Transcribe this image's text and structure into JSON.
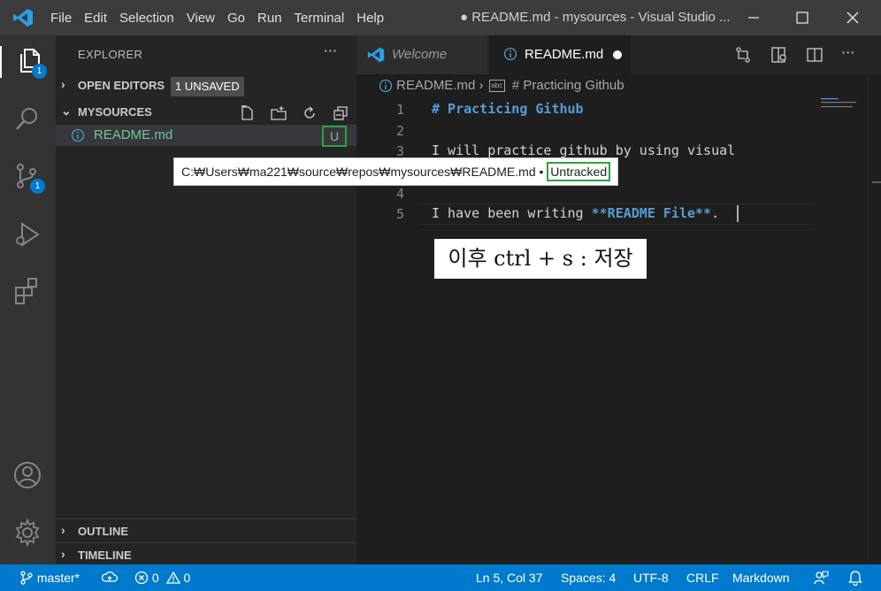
{
  "menu": [
    "File",
    "Edit",
    "Selection",
    "View",
    "Go",
    "Run",
    "Terminal",
    "Help"
  ],
  "window_title": "● README.md - mysources - Visual Studio ...",
  "activity_badges": {
    "explorer": "1",
    "scm": "1"
  },
  "sidebar": {
    "title": "EXPLORER",
    "open_editors_label": "OPEN EDITORS",
    "unsaved_badge": "1 UNSAVED",
    "folder_label": "MYSOURCES",
    "file_name": "README.md",
    "file_status": "U",
    "outline_label": "OUTLINE",
    "timeline_label": "TIMELINE"
  },
  "tooltip": {
    "path": "C:₩Users₩ma221₩source₩repos₩mysources₩README.md • ",
    "status": "Untracked"
  },
  "tabs": {
    "welcome": "Welcome",
    "readme": "README.md"
  },
  "breadcrumb": {
    "file": "README.md",
    "symbol": "# Practicing Github",
    "abc": "abc"
  },
  "editor": {
    "line_numbers": [
      "1",
      "2",
      "3",
      "4",
      "5"
    ],
    "line1": "# Practicing Github",
    "line3": "I will practice github by using visual",
    "line5_prefix": "I have been writing ",
    "line5_bold": "**README File**",
    "line5_suffix": "."
  },
  "annotation": "이후 ctrl + s : 저장",
  "statusbar": {
    "branch": "master*",
    "errors": "0",
    "warnings": "0",
    "position": "Ln 5, Col 37",
    "spaces": "Spaces: 4",
    "encoding": "UTF-8",
    "eol": "CRLF",
    "language": "Markdown"
  },
  "colors": {
    "accent": "#007acc",
    "untracked_green": "#73c991",
    "highlight_box": "#2ea043",
    "heading_blue": "#569cd6"
  }
}
